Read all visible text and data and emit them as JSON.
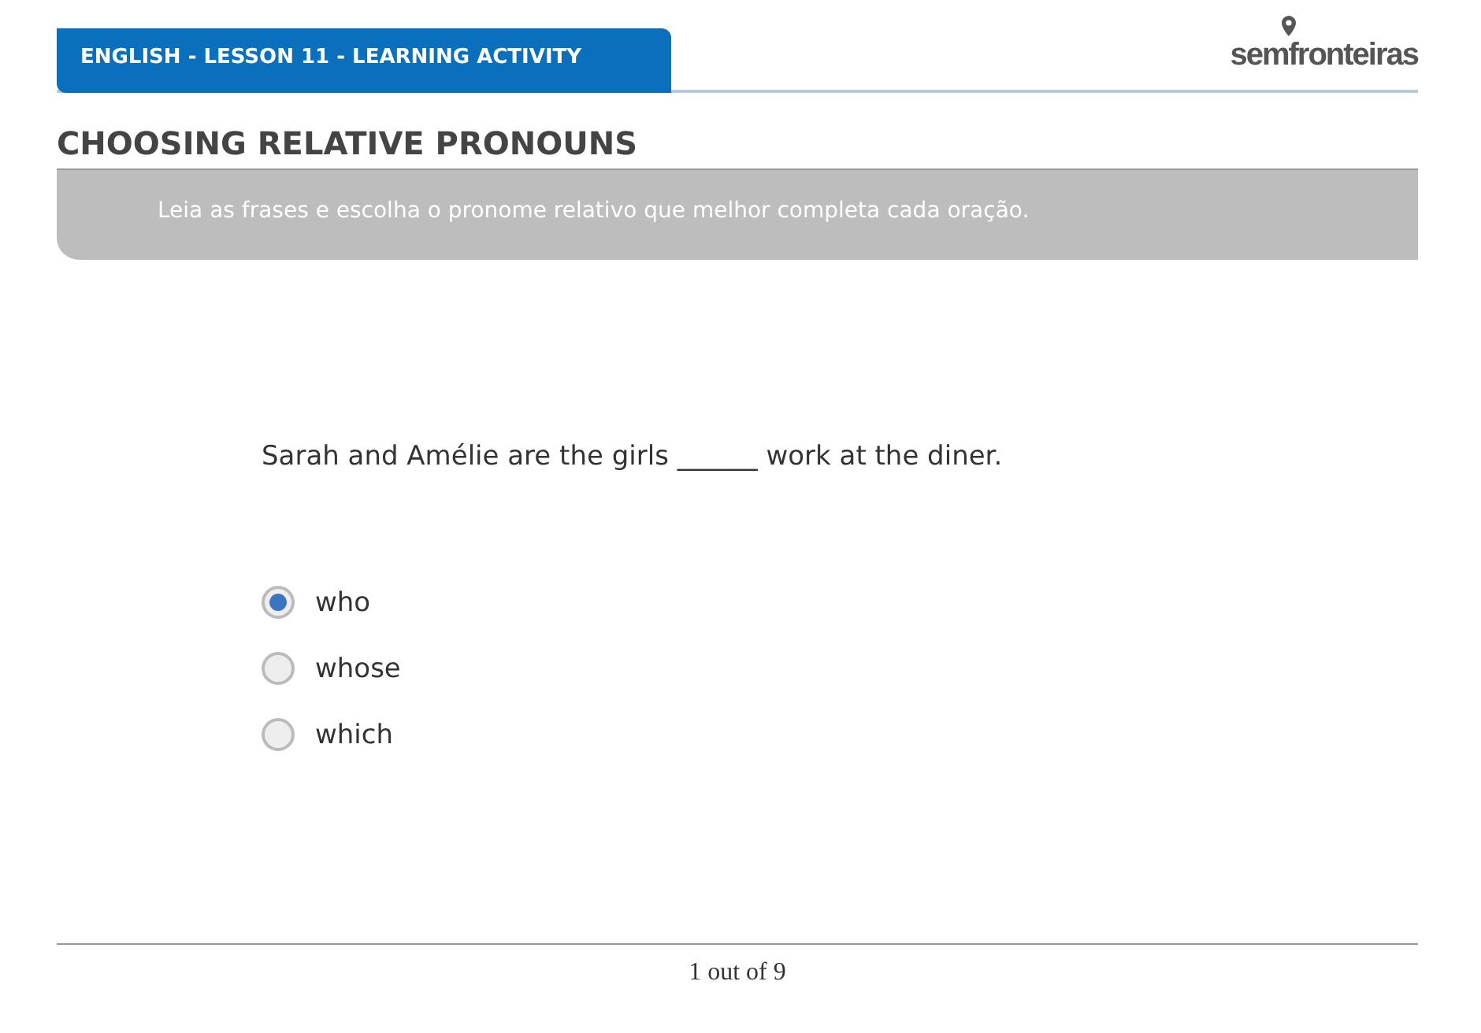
{
  "header": {
    "title": "ENGLISH - LESSON 11 - LEARNING ACTIVITY",
    "logo": "semfronteiras"
  },
  "heading": "CHOOSING RELATIVE PRONOUNS",
  "instructions": "Leia as frases e escolha o pronome relativo que melhor completa cada oração.",
  "question": "Sarah and Amélie are the girls ______ work at the diner.",
  "options": [
    {
      "label": "who",
      "selected": true
    },
    {
      "label": "whose",
      "selected": false
    },
    {
      "label": "which",
      "selected": false
    }
  ],
  "pager": "1 out of 9"
}
